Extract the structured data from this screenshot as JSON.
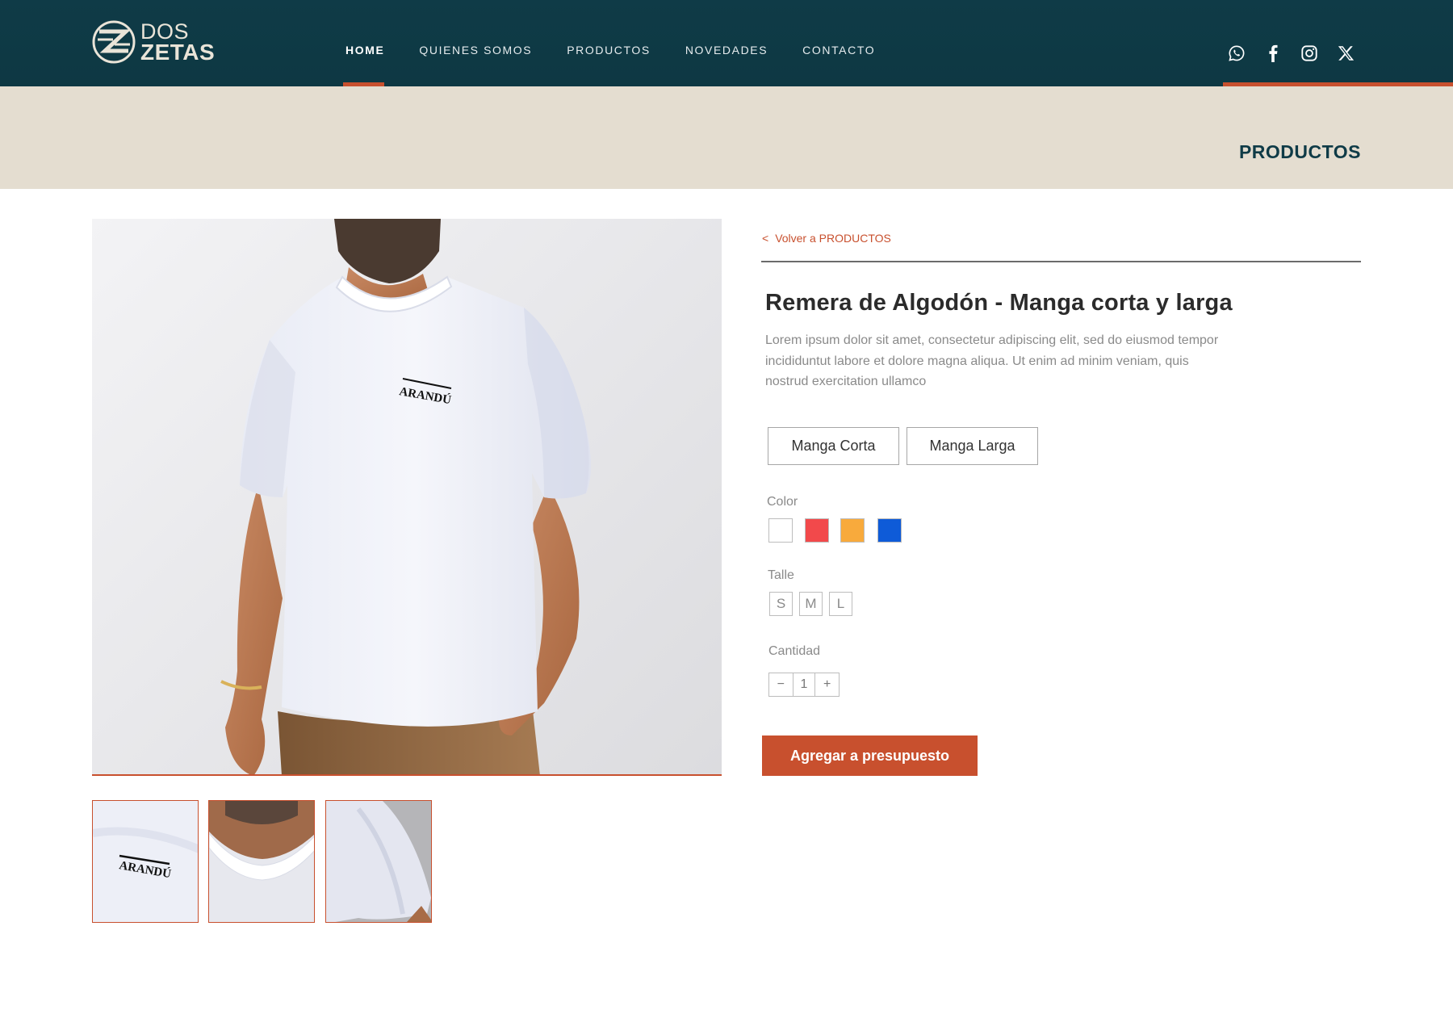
{
  "header": {
    "logo": {
      "line1": "DOS",
      "line2": "ZETAS"
    },
    "nav": [
      {
        "label": "HOME",
        "active": true
      },
      {
        "label": "QUIENES SOMOS",
        "active": false
      },
      {
        "label": "PRODUCTOS",
        "active": false
      },
      {
        "label": "NOVEDADES",
        "active": false
      },
      {
        "label": "CONTACTO",
        "active": false
      }
    ],
    "social": [
      "whatsapp-icon",
      "facebook-icon",
      "instagram-icon",
      "x-twitter-icon"
    ]
  },
  "banner": {
    "title": "PRODUCTOS"
  },
  "product": {
    "back_link": "Volver a PRODUCTOS",
    "back_chevron": "<",
    "title": "Remera de Algodón - Manga corta y larga",
    "description": "Lorem ipsum dolor sit amet, consectetur adipiscing elit, sed do eiusmod tempor incididuntut labore et dolore magna aliqua. Ut enim ad minim veniam, quis nostrud exercitation ullamco",
    "sleeve_options": [
      "Manga Corta",
      "Manga Larga"
    ],
    "color_label": "Color",
    "colors": [
      "#ffffff",
      "#f2494b",
      "#f8aa3c",
      "#0e5bd8"
    ],
    "size_label": "Talle",
    "sizes": [
      "S",
      "M",
      "L"
    ],
    "quantity_label": "Cantidad",
    "quantity": {
      "minus": "−",
      "value": "1",
      "plus": "+"
    },
    "cta": "Agregar a presupuesto",
    "image_text": "ARANDÚ"
  },
  "colors": {
    "header_bg": "#0f3b47",
    "accent": "#c8502e",
    "banner_bg": "#e4ddd0"
  }
}
